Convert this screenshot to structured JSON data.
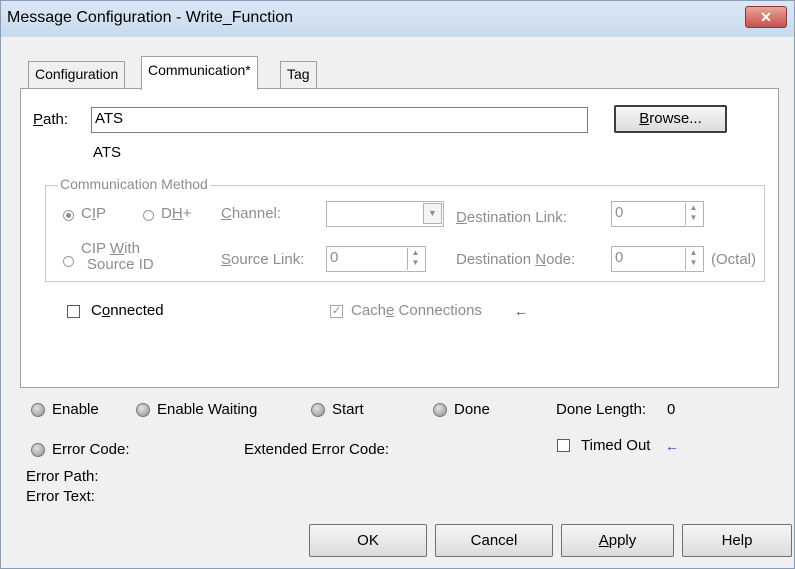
{
  "window": {
    "title": "Message Configuration - Write_Function",
    "close_glyph": "✕"
  },
  "tabs": [
    {
      "label": "Configuration",
      "active": false
    },
    {
      "label": "Communication*",
      "active": true
    },
    {
      "label": "Tag",
      "active": false
    }
  ],
  "path": {
    "label_first": "P",
    "label_rest": "ath:",
    "value": "ATS",
    "resolved": "ATS",
    "browse_first": "B",
    "browse_rest": "rowse..."
  },
  "comm_method": {
    "title": "Communication Method",
    "cip_first": "C",
    "cip_u": "I",
    "cip_rest": "P",
    "dh_first": "D",
    "dh_u": "H",
    "dh_rest": "+",
    "channel_first": "C",
    "channel_rest": "hannel:",
    "channel_value": "",
    "dest_link_first": "D",
    "dest_link_rest": "estination Link:",
    "dest_link_value": "0",
    "cip_with_line1_a": "CIP ",
    "cip_with_line1_u": "W",
    "cip_with_line1_b": "ith",
    "cip_with_line2": "Source ID",
    "source_link_first": "S",
    "source_link_rest": "ource Link:",
    "source_link_value": "0",
    "dest_node_a": "Destination ",
    "dest_node_u": "N",
    "dest_node_b": "ode:",
    "dest_node_value": "0",
    "octal": "(Octal)",
    "selected": "CIP"
  },
  "options": {
    "connected_first": "C",
    "connected_u": "o",
    "connected_rest": "nnected",
    "connected_checked": false,
    "cache_a": "Cach",
    "cache_u": "e",
    "cache_b": " Connections",
    "cache_checked": true,
    "arrow_glyph": "←"
  },
  "status": {
    "enable": "Enable",
    "enable_waiting": "Enable Waiting",
    "start": "Start",
    "done": "Done",
    "done_length_label": "Done Length:",
    "done_length_value": "0",
    "error_code": "Error Code:",
    "extended_error_code": "Extended Error Code:",
    "timed_out": "Timed Out",
    "timed_out_checked": false,
    "error_path": "Error Path:",
    "error_text": "Error Text:"
  },
  "buttons": {
    "ok": "OK",
    "cancel": "Cancel",
    "apply_u": "A",
    "apply_rest": "pply",
    "help": "Help"
  },
  "colors": {
    "titlebar": "#c9daee",
    "close_button": "#c75050",
    "arrow": "#1d3fb0",
    "disabled_text": "#8d8d8d"
  }
}
